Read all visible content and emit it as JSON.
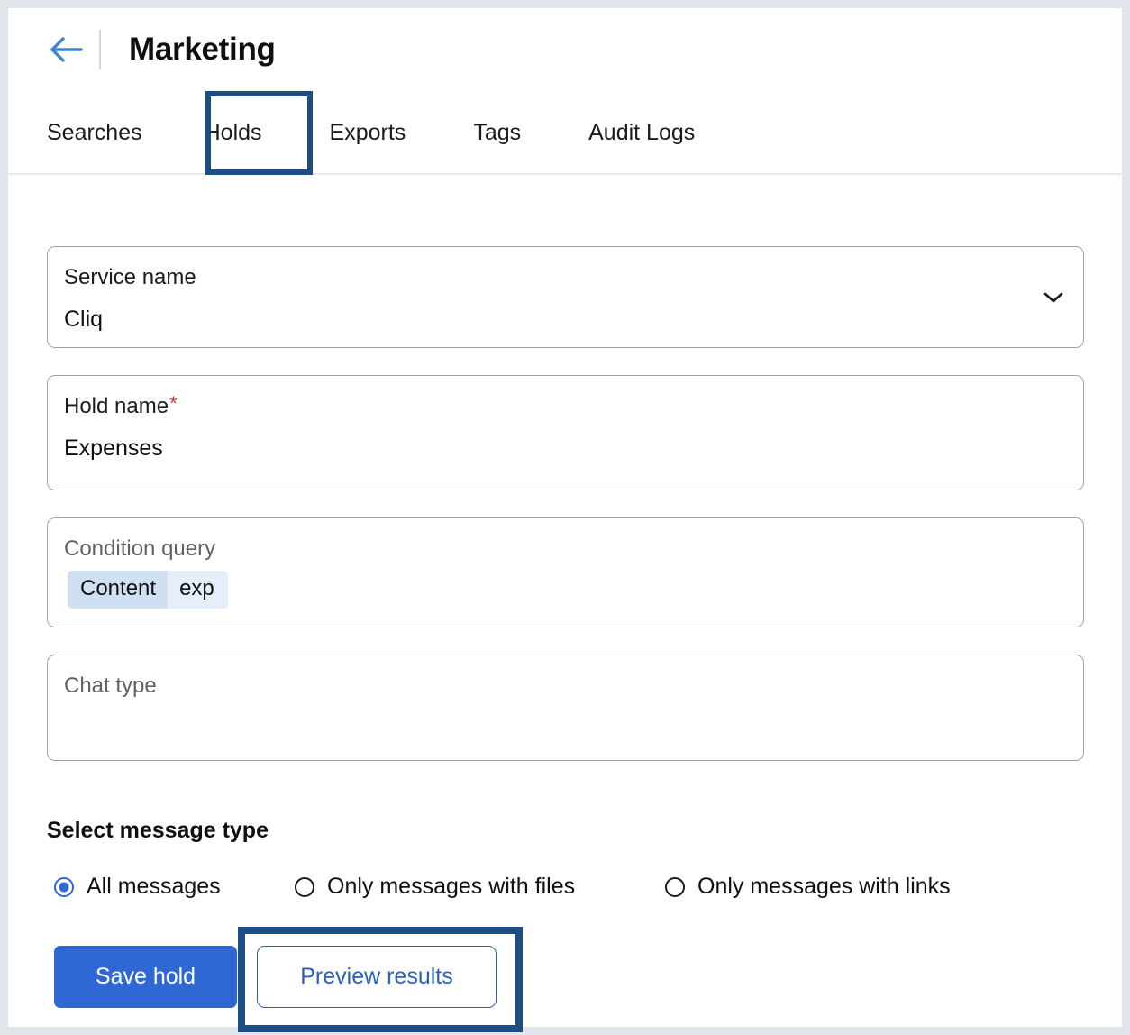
{
  "header": {
    "back_icon": "arrow-left-icon",
    "title": "Marketing"
  },
  "tabs": [
    {
      "label": "Searches",
      "active": false
    },
    {
      "label": "Holds",
      "active": true
    },
    {
      "label": "Exports",
      "active": false
    },
    {
      "label": "Tags",
      "active": false
    },
    {
      "label": "Audit Logs",
      "active": false
    }
  ],
  "form": {
    "service": {
      "label": "Service name",
      "value": "Cliq",
      "chevron_icon": "chevron-down-icon"
    },
    "hold_name": {
      "label": "Hold name",
      "required_marker": "*",
      "value": "Expenses"
    },
    "condition_query": {
      "label": "Condition query",
      "chip_key": "Content",
      "chip_value": "exp"
    },
    "chat_type": {
      "placeholder": "Chat type",
      "value": ""
    }
  },
  "message_type": {
    "title": "Select message type",
    "options": [
      {
        "label": "All messages",
        "selected": true
      },
      {
        "label": "Only messages with files",
        "selected": false
      },
      {
        "label": "Only messages with links",
        "selected": false
      }
    ]
  },
  "actions": {
    "save_label": "Save hold",
    "preview_label": "Preview results"
  },
  "colors": {
    "primary_blue": "#2f68d4",
    "link_blue": "#2b5fbf",
    "annotation_navy": "#1c4e84",
    "required_red": "#d0342c",
    "chip_key_bg": "#cfe0f3",
    "chip_value_bg": "#e6eefa",
    "page_border": "#dfe5ea"
  }
}
